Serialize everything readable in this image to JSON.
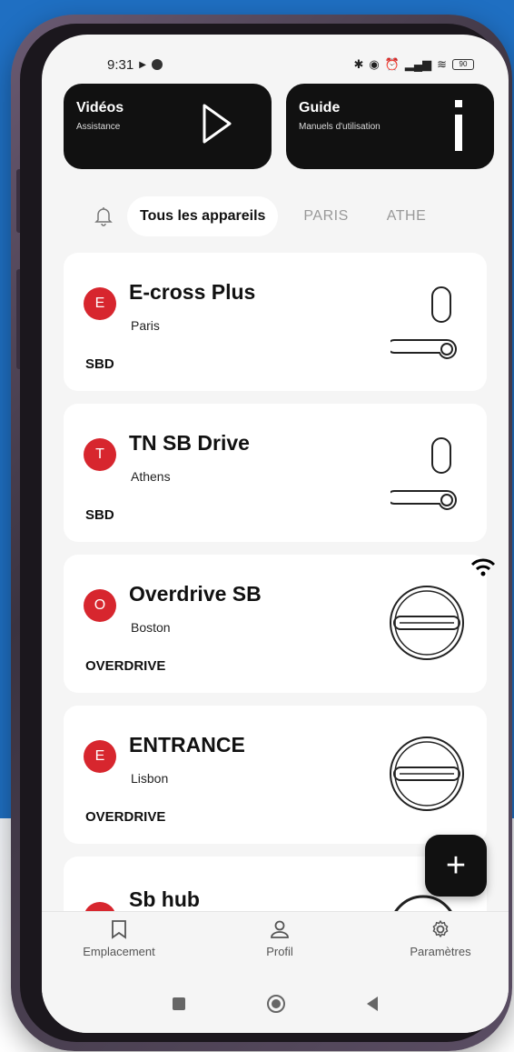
{
  "status": {
    "time": "9:31",
    "battery": "90"
  },
  "top_cards": [
    {
      "title": "Vidéos",
      "subtitle": "Assistance",
      "icon": "play-icon"
    },
    {
      "title": "Guide",
      "subtitle": "Manuels d'utilisation",
      "icon": "info-icon"
    }
  ],
  "tabs": {
    "all": "Tous les appareils",
    "paris": "PARIS",
    "athens": "ATHE"
  },
  "devices": [
    {
      "initial": "E",
      "name": "E-cross Plus",
      "city": "Paris",
      "type": "SBD",
      "image": "door-handle"
    },
    {
      "initial": "T",
      "name": "TN SB Drive",
      "city": "Athens",
      "type": "SBD",
      "image": "door-handle"
    },
    {
      "initial": "O",
      "name": "Overdrive SB",
      "city": "Boston",
      "type": "OVERDRIVE",
      "image": "round-lock"
    },
    {
      "initial": "E",
      "name": "ENTRANCE",
      "city": "Lisbon",
      "type": "OVERDRIVE",
      "image": "round-lock"
    },
    {
      "initial": "S",
      "name": "Sb hub",
      "image": "hub"
    }
  ],
  "fab_label": "+",
  "bottom_nav": [
    {
      "label": "Emplacement",
      "icon": "bookmark-icon"
    },
    {
      "label": "Profil",
      "icon": "person-icon"
    },
    {
      "label": "Paramètres",
      "icon": "gear-icon"
    }
  ],
  "colors": {
    "accent": "#d7262e",
    "dark": "#111111",
    "background": "#f5f5f5",
    "backdrop": "#1f6fc2"
  }
}
